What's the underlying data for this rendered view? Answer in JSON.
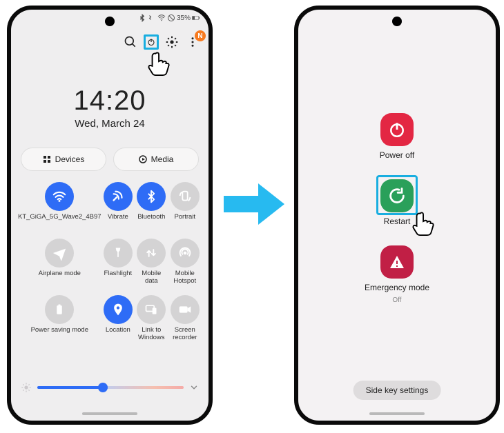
{
  "status_bar": {
    "battery_text": "35%"
  },
  "top_icons": {
    "search": "search-icon",
    "power": "power-icon",
    "settings": "gear-icon",
    "notif_badge": "N"
  },
  "clock": {
    "time": "14:20",
    "date": "Wed, March 24"
  },
  "pills": {
    "devices": "Devices",
    "media": "Media"
  },
  "toggles": [
    {
      "label": "KT_GiGA_5G_Wave2_4B97",
      "active": true,
      "icon": "wifi"
    },
    {
      "label": "Vibrate",
      "active": true,
      "icon": "vibrate"
    },
    {
      "label": "Bluetooth",
      "active": true,
      "icon": "bluetooth"
    },
    {
      "label": "Portrait",
      "active": false,
      "icon": "rotate"
    },
    {
      "label": "Airplane mode",
      "active": false,
      "icon": "plane"
    },
    {
      "label": "Flashlight",
      "active": false,
      "icon": "flash"
    },
    {
      "label": "Mobile data",
      "active": false,
      "icon": "data"
    },
    {
      "label": "Mobile Hotspot",
      "active": false,
      "icon": "hotspot"
    },
    {
      "label": "Power saving mode",
      "active": false,
      "icon": "battery"
    },
    {
      "label": "Location",
      "active": true,
      "icon": "location"
    },
    {
      "label": "Link to Windows",
      "active": false,
      "icon": "link"
    },
    {
      "label": "Screen recorder",
      "active": false,
      "icon": "record"
    }
  ],
  "power_menu": {
    "power_off": {
      "label": "Power off",
      "color": "#e32743"
    },
    "restart": {
      "label": "Restart",
      "color": "#2aa05a"
    },
    "emergency": {
      "label": "Emergency mode",
      "sub": "Off",
      "color": "#c11f45"
    }
  },
  "side_key": "Side key settings"
}
